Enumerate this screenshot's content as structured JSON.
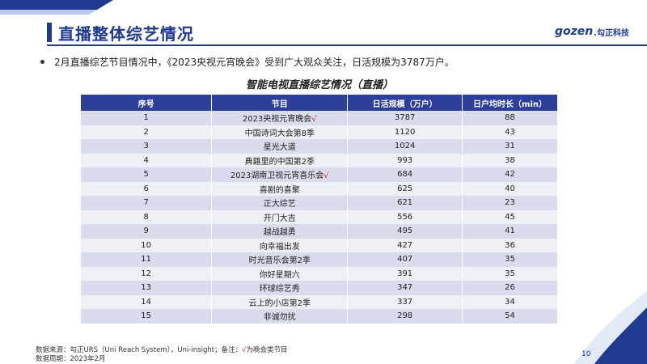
{
  "header": {
    "title": "直播整体综艺情况",
    "logo_mark": "gozen",
    "logo_cn": ".勾正科技"
  },
  "bullet": "2月直播综艺节目情况中，《2023央视元宵晚会》受到广大观众关注，日活规模为3787万户。",
  "table_title": "智能电视直播综艺情况（直播）",
  "table": {
    "headers": [
      "序号",
      "节目",
      "日活规模（万户）",
      "日户均时长（min）"
    ],
    "rows": [
      {
        "no": "1",
        "name": "2023央视元宵晚会",
        "check": "√",
        "dau": "3787",
        "dur": "88"
      },
      {
        "no": "2",
        "name": "中国诗词大会第8季",
        "check": "",
        "dau": "1120",
        "dur": "43"
      },
      {
        "no": "3",
        "name": "星光大道",
        "check": "",
        "dau": "1024",
        "dur": "31"
      },
      {
        "no": "4",
        "name": "典籍里的中国第2季",
        "check": "",
        "dau": "993",
        "dur": "38"
      },
      {
        "no": "5",
        "name": "2023湖南卫视元宵喜乐会",
        "check": "√",
        "dau": "684",
        "dur": "42"
      },
      {
        "no": "6",
        "name": "喜剧的喜聚",
        "check": "",
        "dau": "625",
        "dur": "40"
      },
      {
        "no": "7",
        "name": "正大综艺",
        "check": "",
        "dau": "621",
        "dur": "23"
      },
      {
        "no": "8",
        "name": "开门大吉",
        "check": "",
        "dau": "556",
        "dur": "45"
      },
      {
        "no": "9",
        "name": "越战越勇",
        "check": "",
        "dau": "495",
        "dur": "41"
      },
      {
        "no": "10",
        "name": "向幸福出发",
        "check": "",
        "dau": "427",
        "dur": "36"
      },
      {
        "no": "11",
        "name": "时光音乐会第2季",
        "check": "",
        "dau": "407",
        "dur": "35"
      },
      {
        "no": "12",
        "name": "你好星期六",
        "check": "",
        "dau": "391",
        "dur": "35"
      },
      {
        "no": "13",
        "name": "环球综艺秀",
        "check": "",
        "dau": "347",
        "dur": "26"
      },
      {
        "no": "14",
        "name": "云上的小店第2季",
        "check": "",
        "dau": "337",
        "dur": "34"
      },
      {
        "no": "15",
        "name": "非诚勿扰",
        "check": "",
        "dau": "298",
        "dur": "54"
      }
    ]
  },
  "footnote": {
    "line1_prefix": "数据来源：勾正URS（Uni Reach System），Uni-insight；备注：",
    "line1_check": "√",
    "line1_suffix": "为晚会类节目",
    "line2": "数据周期：2023年2月"
  },
  "page_number": "10",
  "colors": {
    "brand": "#1f3a8f",
    "header_bg": "#2e3f99",
    "row_alt": "#d9dcec",
    "row_norm": "#eef0f6",
    "check": "#e01919"
  }
}
